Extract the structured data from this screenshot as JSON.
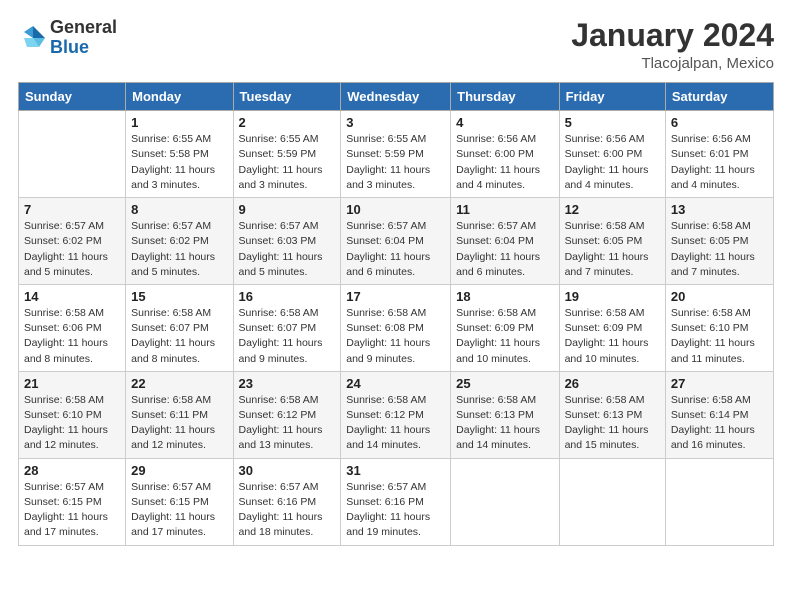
{
  "logo": {
    "general": "General",
    "blue": "Blue"
  },
  "header": {
    "month": "January 2024",
    "location": "Tlacojalpan, Mexico"
  },
  "weekdays": [
    "Sunday",
    "Monday",
    "Tuesday",
    "Wednesday",
    "Thursday",
    "Friday",
    "Saturday"
  ],
  "weeks": [
    [
      {
        "day": "",
        "info": ""
      },
      {
        "day": "1",
        "info": "Sunrise: 6:55 AM\nSunset: 5:58 PM\nDaylight: 11 hours\nand 3 minutes."
      },
      {
        "day": "2",
        "info": "Sunrise: 6:55 AM\nSunset: 5:59 PM\nDaylight: 11 hours\nand 3 minutes."
      },
      {
        "day": "3",
        "info": "Sunrise: 6:55 AM\nSunset: 5:59 PM\nDaylight: 11 hours\nand 3 minutes."
      },
      {
        "day": "4",
        "info": "Sunrise: 6:56 AM\nSunset: 6:00 PM\nDaylight: 11 hours\nand 4 minutes."
      },
      {
        "day": "5",
        "info": "Sunrise: 6:56 AM\nSunset: 6:00 PM\nDaylight: 11 hours\nand 4 minutes."
      },
      {
        "day": "6",
        "info": "Sunrise: 6:56 AM\nSunset: 6:01 PM\nDaylight: 11 hours\nand 4 minutes."
      }
    ],
    [
      {
        "day": "7",
        "info": "Sunrise: 6:57 AM\nSunset: 6:02 PM\nDaylight: 11 hours\nand 5 minutes."
      },
      {
        "day": "8",
        "info": "Sunrise: 6:57 AM\nSunset: 6:02 PM\nDaylight: 11 hours\nand 5 minutes."
      },
      {
        "day": "9",
        "info": "Sunrise: 6:57 AM\nSunset: 6:03 PM\nDaylight: 11 hours\nand 5 minutes."
      },
      {
        "day": "10",
        "info": "Sunrise: 6:57 AM\nSunset: 6:04 PM\nDaylight: 11 hours\nand 6 minutes."
      },
      {
        "day": "11",
        "info": "Sunrise: 6:57 AM\nSunset: 6:04 PM\nDaylight: 11 hours\nand 6 minutes."
      },
      {
        "day": "12",
        "info": "Sunrise: 6:58 AM\nSunset: 6:05 PM\nDaylight: 11 hours\nand 7 minutes."
      },
      {
        "day": "13",
        "info": "Sunrise: 6:58 AM\nSunset: 6:05 PM\nDaylight: 11 hours\nand 7 minutes."
      }
    ],
    [
      {
        "day": "14",
        "info": "Sunrise: 6:58 AM\nSunset: 6:06 PM\nDaylight: 11 hours\nand 8 minutes."
      },
      {
        "day": "15",
        "info": "Sunrise: 6:58 AM\nSunset: 6:07 PM\nDaylight: 11 hours\nand 8 minutes."
      },
      {
        "day": "16",
        "info": "Sunrise: 6:58 AM\nSunset: 6:07 PM\nDaylight: 11 hours\nand 9 minutes."
      },
      {
        "day": "17",
        "info": "Sunrise: 6:58 AM\nSunset: 6:08 PM\nDaylight: 11 hours\nand 9 minutes."
      },
      {
        "day": "18",
        "info": "Sunrise: 6:58 AM\nSunset: 6:09 PM\nDaylight: 11 hours\nand 10 minutes."
      },
      {
        "day": "19",
        "info": "Sunrise: 6:58 AM\nSunset: 6:09 PM\nDaylight: 11 hours\nand 10 minutes."
      },
      {
        "day": "20",
        "info": "Sunrise: 6:58 AM\nSunset: 6:10 PM\nDaylight: 11 hours\nand 11 minutes."
      }
    ],
    [
      {
        "day": "21",
        "info": "Sunrise: 6:58 AM\nSunset: 6:10 PM\nDaylight: 11 hours\nand 12 minutes."
      },
      {
        "day": "22",
        "info": "Sunrise: 6:58 AM\nSunset: 6:11 PM\nDaylight: 11 hours\nand 12 minutes."
      },
      {
        "day": "23",
        "info": "Sunrise: 6:58 AM\nSunset: 6:12 PM\nDaylight: 11 hours\nand 13 minutes."
      },
      {
        "day": "24",
        "info": "Sunrise: 6:58 AM\nSunset: 6:12 PM\nDaylight: 11 hours\nand 14 minutes."
      },
      {
        "day": "25",
        "info": "Sunrise: 6:58 AM\nSunset: 6:13 PM\nDaylight: 11 hours\nand 14 minutes."
      },
      {
        "day": "26",
        "info": "Sunrise: 6:58 AM\nSunset: 6:13 PM\nDaylight: 11 hours\nand 15 minutes."
      },
      {
        "day": "27",
        "info": "Sunrise: 6:58 AM\nSunset: 6:14 PM\nDaylight: 11 hours\nand 16 minutes."
      }
    ],
    [
      {
        "day": "28",
        "info": "Sunrise: 6:57 AM\nSunset: 6:15 PM\nDaylight: 11 hours\nand 17 minutes."
      },
      {
        "day": "29",
        "info": "Sunrise: 6:57 AM\nSunset: 6:15 PM\nDaylight: 11 hours\nand 17 minutes."
      },
      {
        "day": "30",
        "info": "Sunrise: 6:57 AM\nSunset: 6:16 PM\nDaylight: 11 hours\nand 18 minutes."
      },
      {
        "day": "31",
        "info": "Sunrise: 6:57 AM\nSunset: 6:16 PM\nDaylight: 11 hours\nand 19 minutes."
      },
      {
        "day": "",
        "info": ""
      },
      {
        "day": "",
        "info": ""
      },
      {
        "day": "",
        "info": ""
      }
    ]
  ]
}
